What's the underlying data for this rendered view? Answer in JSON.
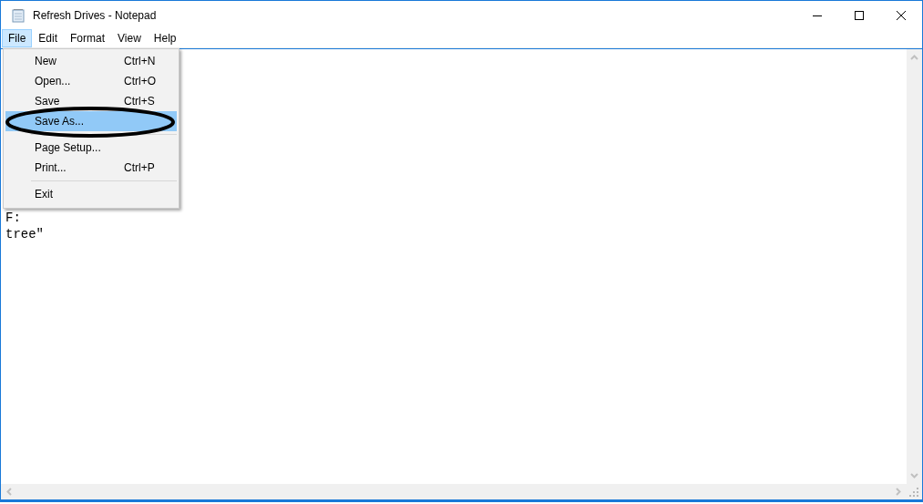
{
  "window": {
    "title": "Refresh Drives - Notepad"
  },
  "menubar": [
    {
      "label": "File",
      "selected": true
    },
    {
      "label": "Edit",
      "selected": false
    },
    {
      "label": "Format",
      "selected": false
    },
    {
      "label": "View",
      "selected": false
    },
    {
      "label": "Help",
      "selected": false
    }
  ],
  "file_menu": [
    {
      "kind": "item",
      "label": "New",
      "shortcut": "Ctrl+N",
      "selected": false,
      "circled": false
    },
    {
      "kind": "item",
      "label": "Open...",
      "shortcut": "Ctrl+O",
      "selected": false,
      "circled": false
    },
    {
      "kind": "item",
      "label": "Save",
      "shortcut": "Ctrl+S",
      "selected": false,
      "circled": false
    },
    {
      "kind": "item",
      "label": "Save As...",
      "selected": true,
      "circled": true
    },
    {
      "kind": "separator"
    },
    {
      "kind": "item",
      "label": "Page Setup...",
      "selected": false,
      "circled": false
    },
    {
      "kind": "item",
      "label": "Print...",
      "shortcut": "Ctrl+P",
      "selected": false,
      "circled": false
    },
    {
      "kind": "separator"
    },
    {
      "kind": "item",
      "label": "Exit",
      "selected": false,
      "circled": false
    }
  ],
  "editor": {
    "lines": [
      "F:",
      "tree\""
    ]
  }
}
